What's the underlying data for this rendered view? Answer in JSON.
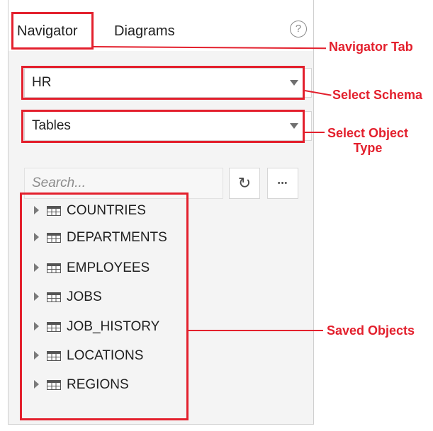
{
  "tabs": [
    {
      "label": "Navigator"
    },
    {
      "label": "Diagrams"
    }
  ],
  "help_icon": "?",
  "schema_select": {
    "value": "HR"
  },
  "object_type_select": {
    "value": "Tables"
  },
  "search": {
    "placeholder": "Search..."
  },
  "refresh_icon": "↻",
  "more_icon": "•••",
  "tree_items": [
    {
      "label": "COUNTRIES"
    },
    {
      "label": "DEPARTMENTS"
    },
    {
      "label": "EMPLOYEES"
    },
    {
      "label": "JOBS"
    },
    {
      "label": "JOB_HISTORY"
    },
    {
      "label": "LOCATIONS"
    },
    {
      "label": "REGIONS"
    }
  ],
  "callouts": {
    "navigator_tab": "Navigator Tab",
    "select_schema": "Select Schema",
    "select_object_type_line1": "Select Object",
    "select_object_type_line2": "Type",
    "saved_objects": "Saved Objects"
  },
  "colors": {
    "annotation_red": "#e3202d",
    "panel_bg": "#f4f4f4"
  }
}
